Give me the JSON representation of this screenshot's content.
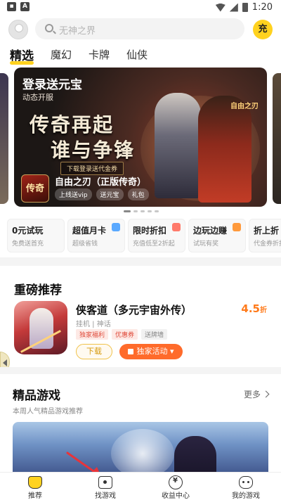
{
  "status_bar": {
    "time": "1:20",
    "left_icons": [
      "notification-icon",
      "app-icon"
    ]
  },
  "header": {
    "search_placeholder": "无神之界",
    "charge_label": "充"
  },
  "tabs": [
    {
      "label": "精选",
      "active": true
    },
    {
      "label": "魔幻",
      "active": false
    },
    {
      "label": "卡牌",
      "active": false
    },
    {
      "label": "仙侠",
      "active": false
    }
  ],
  "banner": {
    "title": "登录送元宝",
    "subtitle": "动态开服",
    "calligraphy_line1": "传奇再起",
    "calligraphy_line2": "谁与争锋",
    "promo_strip": "下载登录送代金券",
    "logo_text": "传奇",
    "game_name": "自由之刃（正版传奇）",
    "chips": [
      "上线送vip",
      "送元宝",
      "礼包"
    ],
    "seal_text": "自由之刃"
  },
  "features": [
    {
      "title": "0元试玩",
      "sub": "免费送首充",
      "icon_color": "#ffffff"
    },
    {
      "title": "超值月卡",
      "sub": "超级省钱",
      "icon_color": "#5aa9ff"
    },
    {
      "title": "限时折扣",
      "sub": "充值低至2折起",
      "icon_color": "#ff7a6b"
    },
    {
      "title": "边玩边赚",
      "sub": "试玩有奖",
      "icon_color": "#ff9a3c"
    },
    {
      "title": "折上折",
      "sub": "代金券折扣",
      "icon_color": "#ffb23c"
    }
  ],
  "featured": {
    "section_title": "重磅推荐",
    "app_name": "侠客道（多元宇宙外传）",
    "meta": "挂机 | 神话",
    "tags": [
      "独家福利",
      "优惠券",
      "送牌墙"
    ],
    "discount_value": "4.5",
    "discount_unit": "折",
    "download_label": "下载",
    "activity_label": "独家活动"
  },
  "quality": {
    "title": "精品游戏",
    "subtitle": "本周人气精品游戏推荐",
    "more_label": "更多"
  },
  "bottom_nav": [
    {
      "label": "推荐",
      "icon": "home-icon"
    },
    {
      "label": "找游戏",
      "icon": "find-games-icon"
    },
    {
      "label": "收益中心",
      "icon": "earnings-icon"
    },
    {
      "label": "我的游戏",
      "icon": "my-games-icon"
    }
  ],
  "colors": {
    "accent": "#ffd21f",
    "orange": "#ff6b2b",
    "annotation": "#e8343a"
  }
}
